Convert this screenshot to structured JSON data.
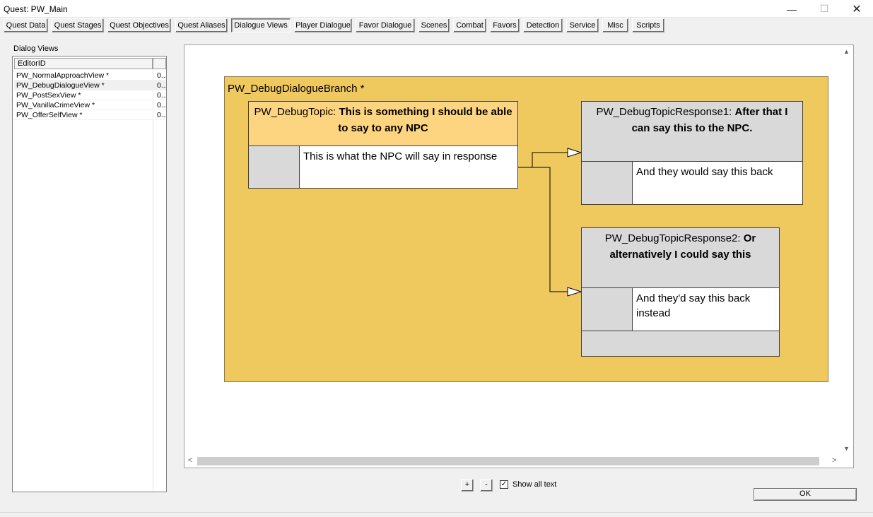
{
  "window": {
    "title": "Quest: PW_Main",
    "minimize": "—",
    "maximize": "☐",
    "close": "✕"
  },
  "tabs": [
    {
      "label": "Quest Data"
    },
    {
      "label": "Quest Stages"
    },
    {
      "label": "Quest Objectives"
    },
    {
      "label": "Quest Aliases"
    },
    {
      "label": "Dialogue Views",
      "active": true
    },
    {
      "label": "Player Dialogue"
    },
    {
      "label": "Favor Dialogue"
    },
    {
      "label": "Scenes"
    },
    {
      "label": "Combat"
    },
    {
      "label": "Favors"
    },
    {
      "label": "Detection"
    },
    {
      "label": "Service"
    },
    {
      "label": "Misc"
    },
    {
      "label": "Scripts"
    }
  ],
  "dialog_views": {
    "label": "Dialog Views",
    "column_header": "EditorID",
    "rows": [
      {
        "id": "PW_NormalApproachView *",
        "col2": "0..."
      },
      {
        "id": "PW_DebugDialogueView *",
        "col2": "0...",
        "selected": true
      },
      {
        "id": "PW_PostSexView *",
        "col2": "0..."
      },
      {
        "id": "PW_VanillaCrimeView *",
        "col2": "0..."
      },
      {
        "id": "PW_OfferSelfView *",
        "col2": "0..."
      }
    ]
  },
  "canvas": {
    "branch_title": "PW_DebugDialogueBranch *",
    "branch_color": "#f0c95e",
    "topic": {
      "name": "PW_DebugTopic:",
      "prompt": "This is something I should be able to say to any NPC",
      "response": "This is what the NPC will say in response",
      "header_color": "#fdd580"
    },
    "response1": {
      "name": "PW_DebugTopicResponse1:",
      "prompt": "After that I can say this to the NPC.",
      "response": "And they would say this back",
      "header_color": "#d9d9d9"
    },
    "response2": {
      "name": "PW_DebugTopicResponse2:",
      "prompt": "Or alternatively I could say this",
      "response": "And they'd say this back instead",
      "header_color": "#d9d9d9"
    },
    "scroll_left": "<",
    "scroll_right": ">",
    "scroll_up": "▲",
    "scroll_down": "▼"
  },
  "bottom": {
    "zoom_in": "+",
    "zoom_out": "-",
    "show_all_text_label": "Show all text",
    "show_all_text_checked": "✓",
    "ok_label": "OK"
  }
}
